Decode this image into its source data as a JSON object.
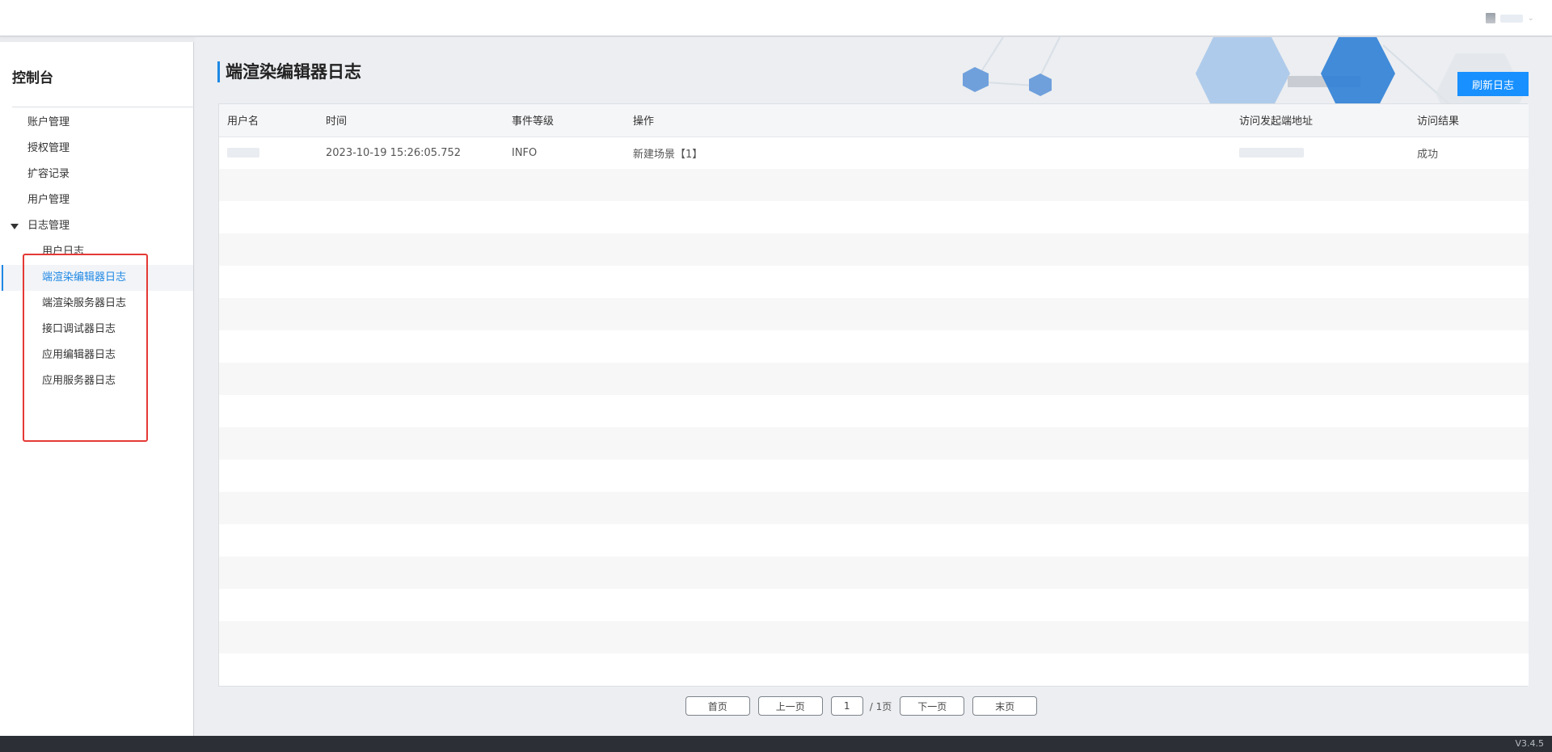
{
  "sidebar": {
    "title": "控制台",
    "items": [
      {
        "label": "账户管理"
      },
      {
        "label": "授权管理"
      },
      {
        "label": "扩容记录"
      },
      {
        "label": "用户管理"
      },
      {
        "label": "日志管理"
      },
      {
        "label": "用户日志"
      },
      {
        "label": "端渲染编辑器日志"
      },
      {
        "label": "端渲染服务器日志"
      },
      {
        "label": "接口调试器日志"
      },
      {
        "label": "应用编辑器日志"
      },
      {
        "label": "应用服务器日志"
      }
    ]
  },
  "main": {
    "title": "端渲染编辑器日志",
    "refresh_label": "刷新日志"
  },
  "table": {
    "headers": [
      "用户名",
      "时间",
      "事件等级",
      "操作",
      "访问发起端地址",
      "访问结果"
    ],
    "rows": [
      {
        "time": "2023-10-19 15:26:05.752",
        "level": "INFO",
        "action": "新建场景【1】",
        "result": "成功"
      }
    ]
  },
  "pager": {
    "first": "首页",
    "prev": "上一页",
    "page": "1",
    "total": "/ 1页",
    "next": "下一页",
    "last": "末页"
  },
  "footer": {
    "version": "V3.4.5"
  },
  "colors": {
    "accent": "#1890ff",
    "highlight": "#e53935",
    "footer": "#2c3036"
  }
}
